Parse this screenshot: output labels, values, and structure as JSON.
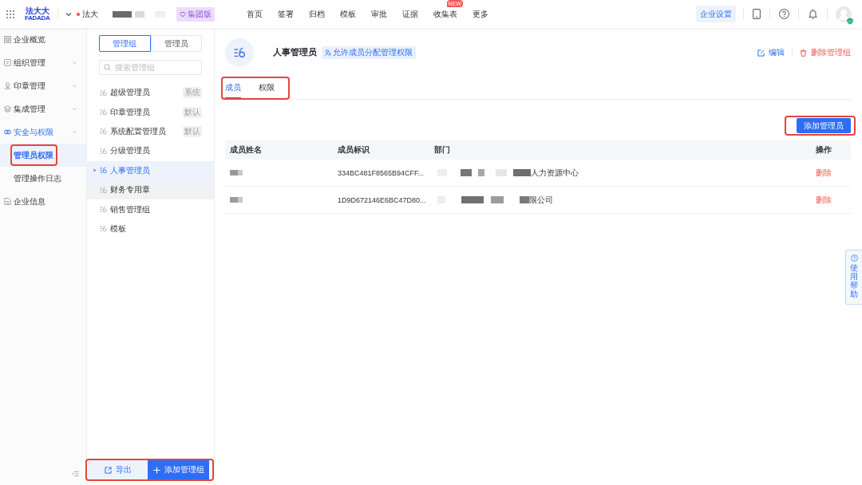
{
  "topbar": {
    "logo": {
      "name": "法大大",
      "wordmark": "FADADA"
    },
    "org": {
      "name": "法大",
      "redacted": true
    },
    "edition_badge": "集团版",
    "nav": [
      {
        "label": "首页"
      },
      {
        "label": "签署"
      },
      {
        "label": "归档"
      },
      {
        "label": "模板"
      },
      {
        "label": "审批"
      },
      {
        "label": "证据"
      },
      {
        "label": "收集表",
        "badge": "NEW"
      },
      {
        "label": "更多"
      }
    ],
    "settings_button": "企业设置"
  },
  "sidebar": {
    "items": [
      {
        "label": "企业概览",
        "kind": "page",
        "active": false
      },
      {
        "label": "组织管理",
        "kind": "menu",
        "active": false,
        "expanded": false
      },
      {
        "label": "印章管理",
        "kind": "menu",
        "active": false,
        "expanded": false
      },
      {
        "label": "集成管理",
        "kind": "menu",
        "active": false,
        "expanded": false
      },
      {
        "label": "安全与权限",
        "kind": "menu",
        "active": true,
        "expanded": true,
        "children": [
          {
            "label": "管理员权限",
            "selected": true,
            "highlighted": true
          },
          {
            "label": "管理操作日志",
            "selected": false,
            "highlighted": false
          }
        ]
      },
      {
        "label": "企业信息",
        "kind": "page",
        "active": false
      }
    ]
  },
  "group_panel": {
    "switch": [
      {
        "label": "管理组",
        "selected": true
      },
      {
        "label": "管理员",
        "selected": false
      }
    ],
    "search": {
      "placeholder": "搜索管理组"
    },
    "groups": [
      {
        "label": "超级管理员",
        "tag": "系统",
        "selected": false,
        "hovered": false
      },
      {
        "label": "印章管理员",
        "tag": "默认",
        "selected": false,
        "hovered": false
      },
      {
        "label": "系统配置管理员",
        "tag": "默认",
        "selected": false,
        "hovered": false
      },
      {
        "label": "分级管理员",
        "selected": false,
        "hovered": false
      },
      {
        "label": "人事管理员",
        "selected": true,
        "hovered": false
      },
      {
        "label": "财务专用章",
        "selected": false,
        "hovered": true
      },
      {
        "label": "销售管理组",
        "selected": false,
        "hovered": false
      },
      {
        "label": "模板",
        "selected": false,
        "hovered": false
      }
    ],
    "footer": {
      "highlighted": true,
      "buttons": [
        {
          "label": "导出",
          "kind": "export"
        },
        {
          "label": "添加管理组",
          "kind": "add"
        }
      ]
    }
  },
  "detail": {
    "title": "人事管理员",
    "tag": "允许成员分配管理权限",
    "actions": [
      {
        "label": "编辑",
        "kind": "edit"
      },
      {
        "label": "删除管理组",
        "kind": "delete"
      }
    ],
    "tabs": {
      "highlighted": true,
      "items": [
        {
          "label": "成员",
          "selected": true
        },
        {
          "label": "权限",
          "selected": false
        }
      ]
    },
    "add_button": {
      "label": "添加管理员",
      "highlighted": true
    },
    "table": {
      "columns": [
        "成员姓名",
        "成员标识",
        "部门",
        "操作"
      ],
      "rows": [
        {
          "name_redacted": true,
          "member_id": "334BC481F8565B94CFF...",
          "department_redacted": true,
          "department": "人力资源中心",
          "action": "删除"
        },
        {
          "name_redacted": true,
          "member_id": "1D9D672146E6BC47D80...",
          "department_redacted": true,
          "department": "限公司",
          "action": "删除"
        }
      ]
    }
  },
  "help": {
    "label": "使用帮助"
  }
}
